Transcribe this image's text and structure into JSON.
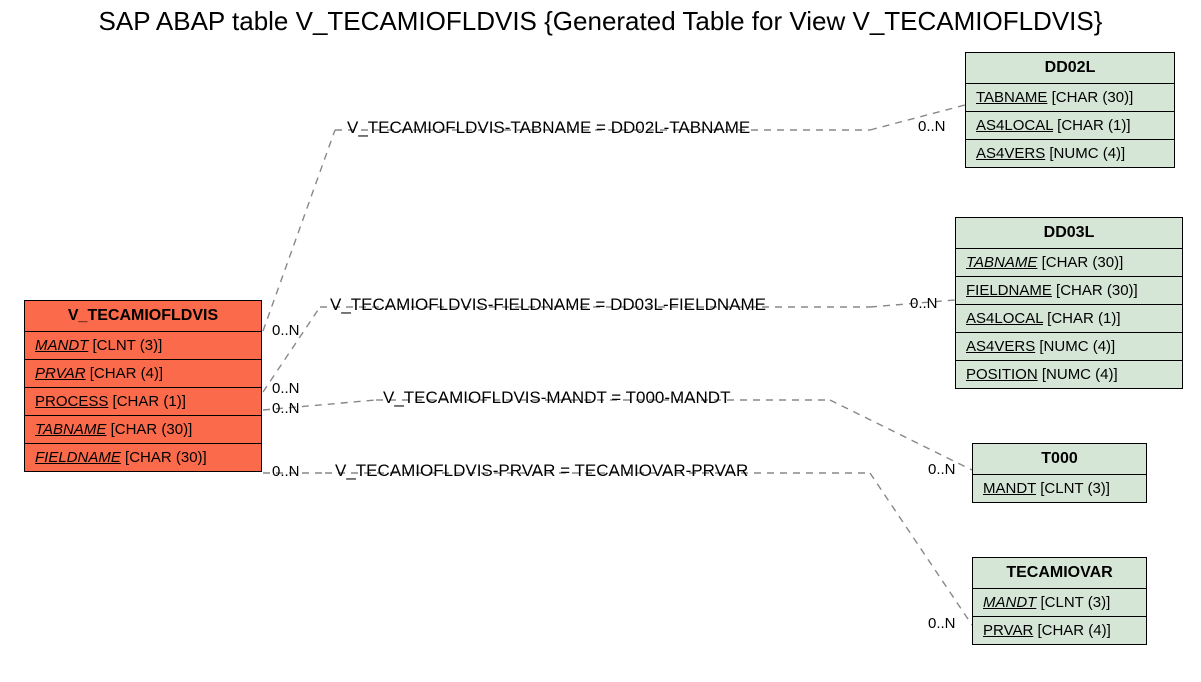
{
  "title": "SAP ABAP table V_TECAMIOFLDVIS {Generated Table for View V_TECAMIOFLDVIS}",
  "main": {
    "name": "V_TECAMIOFLDVIS",
    "fields": [
      {
        "name": "MANDT",
        "type": "[CLNT (3)]",
        "key": true,
        "fk": true
      },
      {
        "name": "PRVAR",
        "type": "[CHAR (4)]",
        "key": true,
        "fk": true
      },
      {
        "name": "PROCESS",
        "type": "[CHAR (1)]",
        "key": true,
        "fk": false
      },
      {
        "name": "TABNAME",
        "type": "[CHAR (30)]",
        "key": true,
        "fk": true
      },
      {
        "name": "FIELDNAME",
        "type": "[CHAR (30)]",
        "key": true,
        "fk": true
      }
    ]
  },
  "refs": {
    "dd02l": {
      "name": "DD02L",
      "fields": [
        {
          "name": "TABNAME",
          "type": "[CHAR (30)]",
          "key": true
        },
        {
          "name": "AS4LOCAL",
          "type": "[CHAR (1)]",
          "key": true
        },
        {
          "name": "AS4VERS",
          "type": "[NUMC (4)]",
          "key": true
        }
      ]
    },
    "dd03l": {
      "name": "DD03L",
      "fields": [
        {
          "name": "TABNAME",
          "type": "[CHAR (30)]",
          "key": true,
          "fk": true
        },
        {
          "name": "FIELDNAME",
          "type": "[CHAR (30)]",
          "key": true
        },
        {
          "name": "AS4LOCAL",
          "type": "[CHAR (1)]",
          "key": true
        },
        {
          "name": "AS4VERS",
          "type": "[NUMC (4)]",
          "key": true
        },
        {
          "name": "POSITION",
          "type": "[NUMC (4)]",
          "key": true
        }
      ]
    },
    "t000": {
      "name": "T000",
      "fields": [
        {
          "name": "MANDT",
          "type": "[CLNT (3)]",
          "key": true
        }
      ]
    },
    "tecamiovar": {
      "name": "TECAMIOVAR",
      "fields": [
        {
          "name": "MANDT",
          "type": "[CLNT (3)]",
          "key": true,
          "fk": true
        },
        {
          "name": "PRVAR",
          "type": "[CHAR (4)]",
          "key": true
        }
      ]
    }
  },
  "rels": {
    "r1": {
      "label": "V_TECAMIOFLDVIS-TABNAME = DD02L-TABNAME",
      "leftCard": "0..N",
      "rightCard": "0..N"
    },
    "r2": {
      "label": "V_TECAMIOFLDVIS-FIELDNAME = DD03L-FIELDNAME",
      "leftCard": "0..N",
      "rightCard": "0..N"
    },
    "r3": {
      "label": "V_TECAMIOFLDVIS-MANDT = T000-MANDT",
      "leftCard": "0..N",
      "rightCard": "0..N"
    },
    "r4": {
      "label": "V_TECAMIOFLDVIS-PRVAR = TECAMIOVAR-PRVAR",
      "leftCard": "0..N",
      "rightCard": "0..N"
    }
  }
}
